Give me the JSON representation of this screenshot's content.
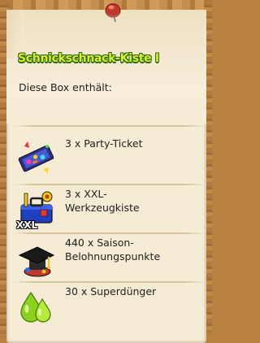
{
  "title": "Schnickschnack-Kiste I",
  "subtitle": "Diese Box enthält:",
  "items": [
    {
      "icon": "party-ticket-icon",
      "text": "3 x Party-Ticket"
    },
    {
      "icon": "toolbox-icon",
      "text": "3 x XXL-\nWerkzeugkiste",
      "badge": "XXL"
    },
    {
      "icon": "graduation-cap-icon",
      "text": "440 x Saison-\nBelohnungspunkte"
    },
    {
      "icon": "fertilizer-drops-icon",
      "text": "30 x Superdünger"
    }
  ],
  "colors": {
    "title_fill": "#d8ee2c",
    "title_outline": "#2e6a10",
    "paper": "#f6ecd6",
    "wood": "#b8813f"
  }
}
